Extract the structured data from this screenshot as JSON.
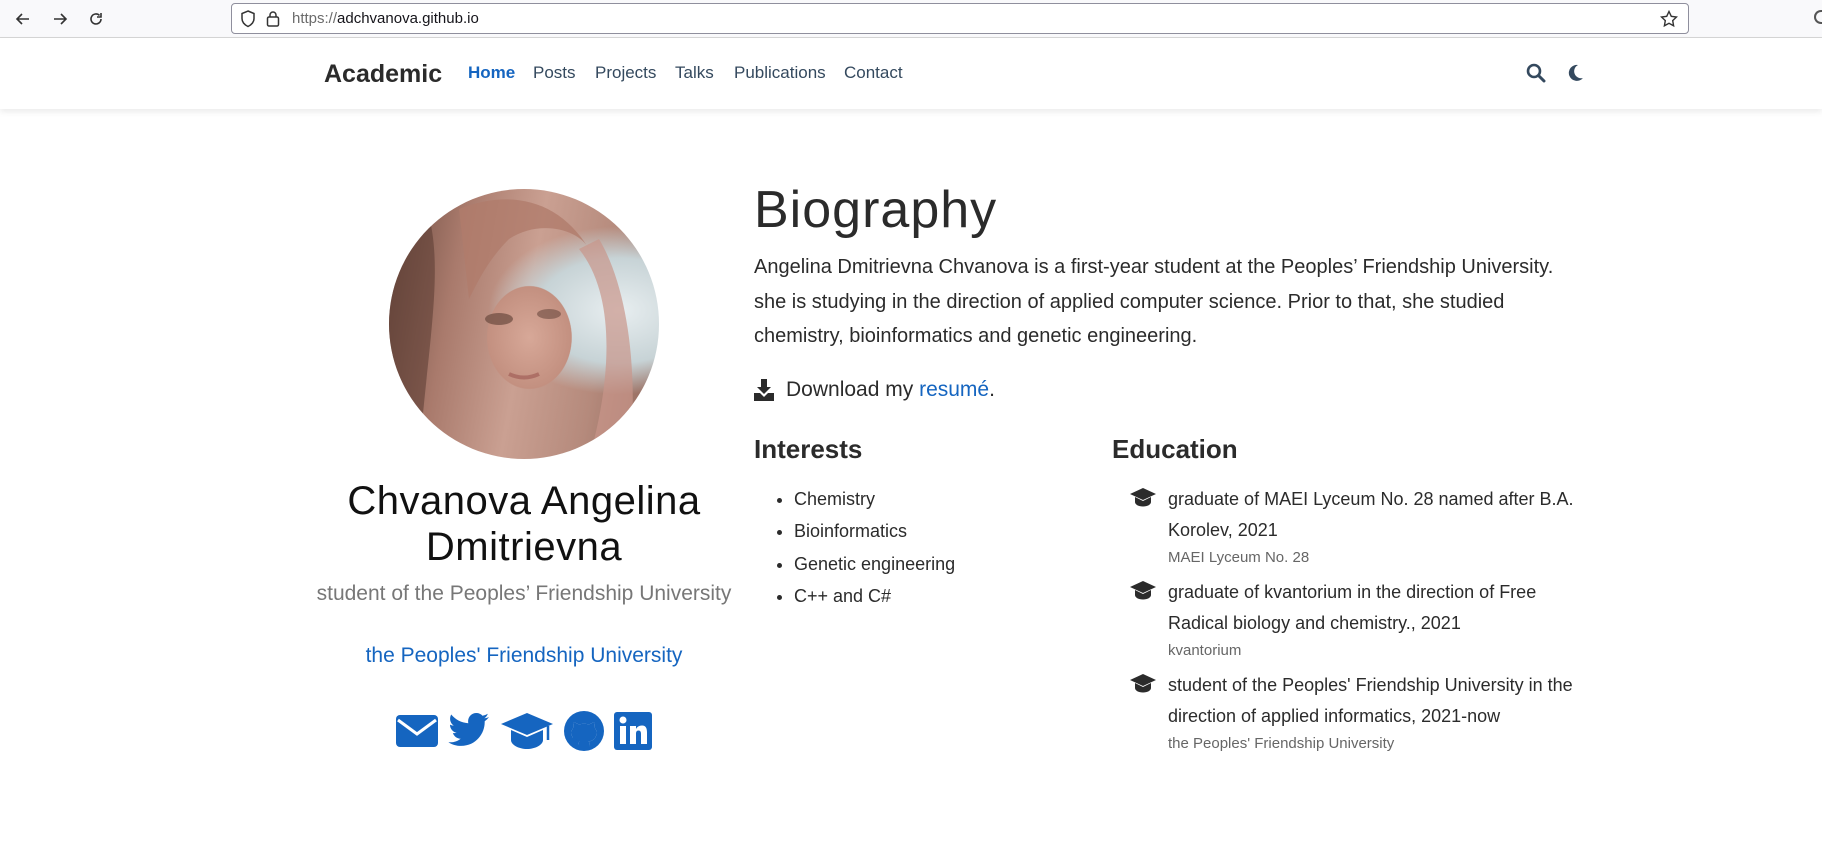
{
  "browser": {
    "url_scheme": "https://",
    "url_host": "adchvanova.github.io"
  },
  "navbar": {
    "brand": "Academic",
    "links": [
      {
        "label": "Home",
        "active": true
      },
      {
        "label": "Posts"
      },
      {
        "label": "Projects"
      },
      {
        "label": "Talks"
      },
      {
        "label": "Publications"
      },
      {
        "label": "Contact"
      }
    ],
    "icons": [
      "search-icon",
      "moon-icon"
    ]
  },
  "profile": {
    "name": "Chvanova Angelina Dmitrievna",
    "role": "student of the Peoples’ Friendship University",
    "organization": "the Peoples' Friendship University",
    "social_icons": [
      "envelope-icon",
      "twitter-icon",
      "graduation-cap-icon",
      "github-icon",
      "linkedin-icon"
    ]
  },
  "biography": {
    "title": "Biography",
    "text": "Angelina Dmitrievna Chvanova is a first-year student at the Peoples’ Friendship University. she is studying in the direction of applied computer science. Prior to that, she studied chemistry, bioinformatics and genetic engineering.",
    "download_prefix": "Download my ",
    "download_link": "resumé",
    "download_suffix": "."
  },
  "interests": {
    "title": "Interests",
    "items": [
      "Chemistry",
      "Bioinformatics",
      "Genetic engineering",
      "C++ and C#"
    ]
  },
  "education": {
    "title": "Education",
    "items": [
      {
        "course": "graduate of MAEI Lyceum No. 28 named after B.A. Korolev, 2021",
        "institution": "MAEI Lyceum No. 28"
      },
      {
        "course": "graduate of kvantorium in the direction of Free Radical biology and chemistry., 2021",
        "institution": "kvantorium"
      },
      {
        "course": "student of the Peoples' Friendship University in the direction of applied informatics, 2021-now",
        "institution": "the Peoples' Friendship University"
      }
    ]
  },
  "colors": {
    "accent": "#1565c0",
    "text": "#2b2b2b",
    "muted": "#666666"
  }
}
